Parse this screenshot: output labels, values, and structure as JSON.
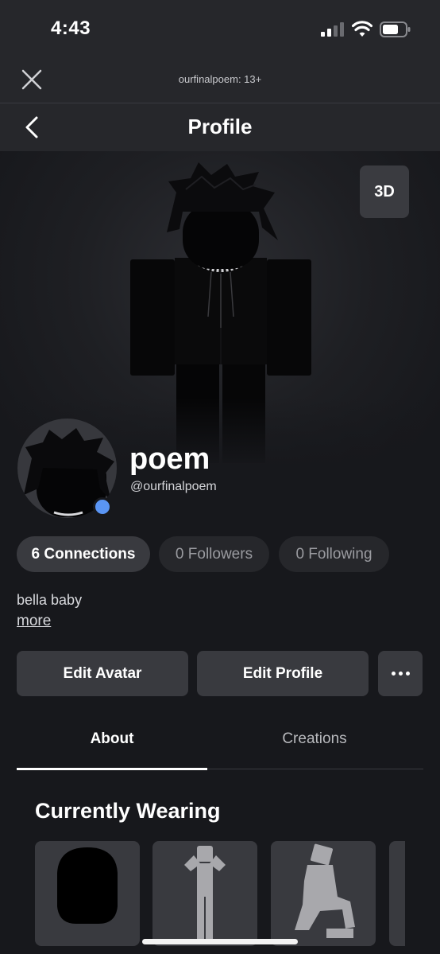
{
  "status_bar": {
    "time": "4:43"
  },
  "web_bar": {
    "site_label": "ourfinalpoem: 13+"
  },
  "nav": {
    "title": "Profile"
  },
  "hero": {
    "view_toggle_label": "3D"
  },
  "profile": {
    "display_name": "poem",
    "username": "@ourfinalpoem",
    "presence_color": "#5a95f4"
  },
  "stats": {
    "connections": "6 Connections",
    "followers": "0 Followers",
    "following": "0 Following"
  },
  "bio": {
    "text": "bella baby",
    "more_label": "more"
  },
  "actions": {
    "edit_avatar": "Edit Avatar",
    "edit_profile": "Edit Profile",
    "more_icon": "ellipsis-icon"
  },
  "tabs": [
    {
      "label": "About",
      "selected": true
    },
    {
      "label": "Creations",
      "selected": false
    }
  ],
  "wearing": {
    "title": "Currently Wearing",
    "items": [
      {
        "icon": "black-head-icon"
      },
      {
        "icon": "pose-animation-icon"
      },
      {
        "icon": "kneel-animation-icon"
      },
      {
        "icon": "partial-item"
      }
    ]
  },
  "colors": {
    "background": "#17181c",
    "bar": "#26272b",
    "button": "#393a3f",
    "accent": "#5a95f4"
  }
}
